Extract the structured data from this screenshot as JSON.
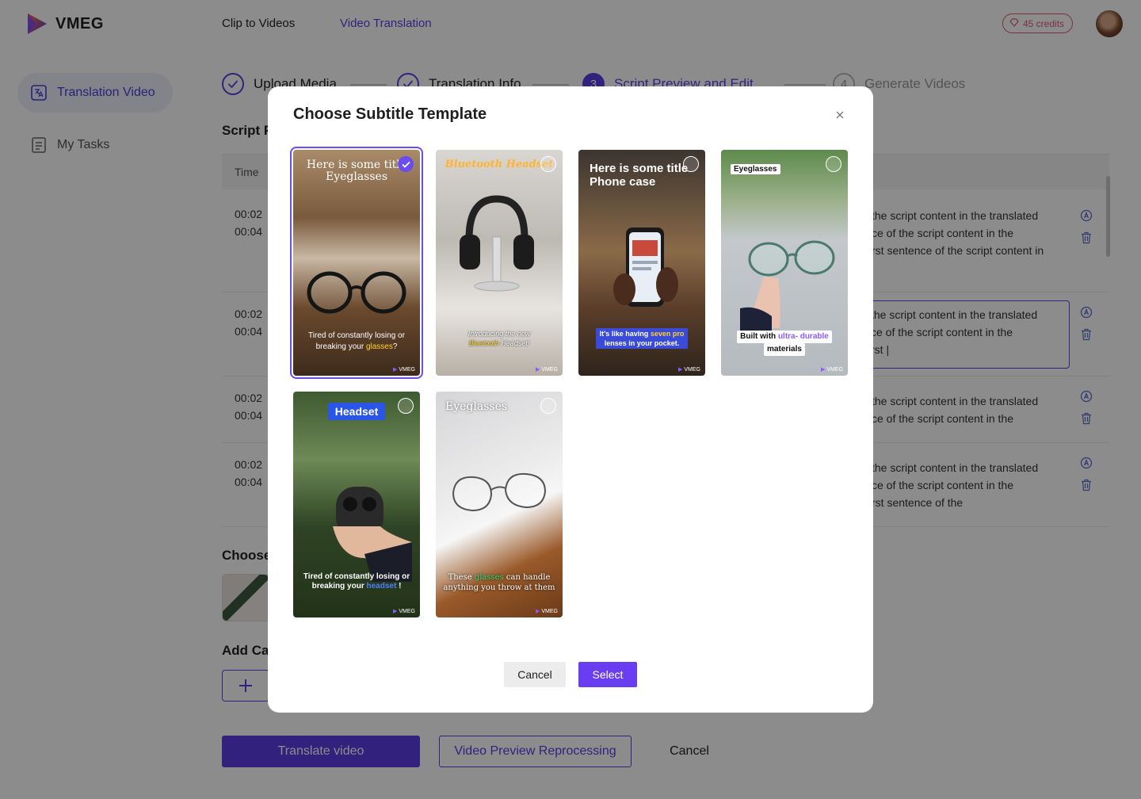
{
  "app": {
    "name": "VMEG"
  },
  "nav": {
    "items": [
      "Clip to Videos",
      "Video Translation"
    ],
    "active": "Video Translation"
  },
  "credits": {
    "label": "45 credits"
  },
  "sidebar": {
    "items": [
      {
        "label": "Translation Video",
        "icon": "translate-icon"
      },
      {
        "label": "My Tasks",
        "icon": "list-icon"
      }
    ]
  },
  "steps": [
    {
      "label": "Upload Media",
      "state": "done"
    },
    {
      "label": "Translation Info",
      "state": "done"
    },
    {
      "label": "Script Preview and Edit",
      "state": "current",
      "number": "3"
    },
    {
      "label": "Generate Videos",
      "state": "todo",
      "number": "4"
    }
  ],
  "page": {
    "script_title": "Script P",
    "table_header_time": "Time",
    "rows": [
      {
        "start": "00:02",
        "end": "00:04",
        "text": "the script content in the translated\nce of the script content in the\nrst sentence of the script content in"
      },
      {
        "start": "00:02",
        "end": "00:04",
        "text": "the script content in the translated\nce of the script content in the\nrst |"
      },
      {
        "start": "00:02",
        "end": "00:04",
        "text": "the script content in the translated\nce of the script content in the"
      },
      {
        "start": "00:02",
        "end": "00:04",
        "text": "the script content in the translated\nce of the script content in the\nrst sentence of the"
      }
    ],
    "choose_title": "Choose",
    "add_caption_title": "Add Cap",
    "translate_button": "Translate video",
    "reprocess_button": "Video Preview Reprocessing",
    "cancel_button": "Cancel"
  },
  "modal": {
    "title": "Choose Subtitle Template",
    "cancel": "Cancel",
    "select": "Select",
    "templates": [
      {
        "title": "Here is some title Eyeglasses",
        "caption_a": "Tired of constantly losing or breaking your ",
        "caption_hl": "glasses",
        "caption_b": "?",
        "selected": true
      },
      {
        "title": "Bluetooth Headset",
        "caption_a": "Introducing the new ",
        "caption_hl": "Bluetooth",
        "caption_b": " Headset!",
        "selected": false
      },
      {
        "title": "Here is some title Phone case",
        "caption_a": "It's like having ",
        "caption_hl": "seven pro",
        "caption_b": " lenses in your pocket.",
        "selected": false
      },
      {
        "title": "Eyeglasses",
        "caption_a": "Built with ",
        "caption_hl": "ultra- durable",
        "caption_b": "materials",
        "selected": false
      },
      {
        "title": "Headset",
        "caption_a": "Tired of constantly losing or breaking your ",
        "caption_hl": "headset",
        "caption_b": " !",
        "selected": false
      },
      {
        "title": "Eyeglasses",
        "caption_a": "These ",
        "caption_hl": "glasses",
        "caption_b": " can handle anything you throw at them",
        "selected": false
      }
    ],
    "watermark": "VMEG"
  }
}
